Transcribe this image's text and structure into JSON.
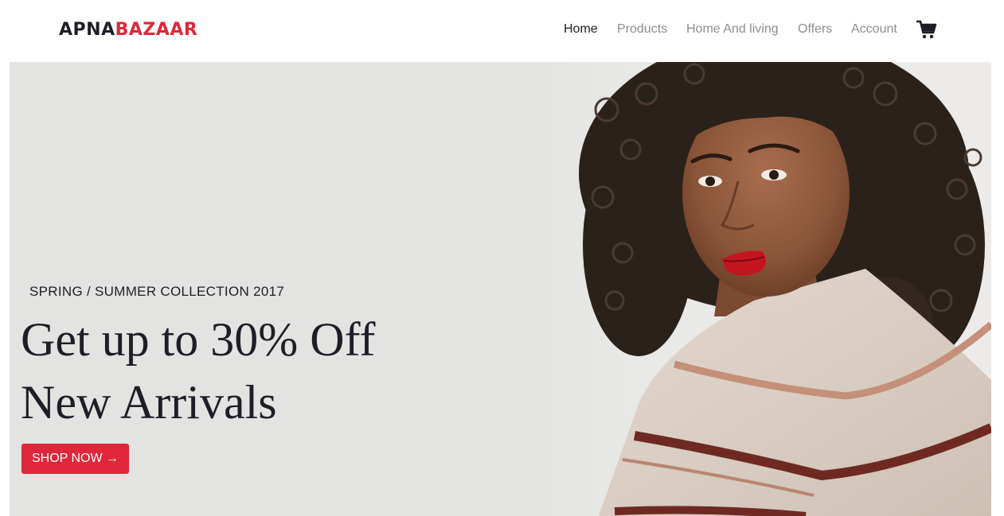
{
  "brand": {
    "part1": "APNA",
    "part2": "BAZAAR",
    "accent_color": "#e0263a",
    "dark_color": "#1e1e27"
  },
  "nav": {
    "items": [
      {
        "label": "Home",
        "active": true
      },
      {
        "label": "Products",
        "active": false
      },
      {
        "label": "Home And living",
        "active": false
      },
      {
        "label": "Offers",
        "active": false
      },
      {
        "label": "Account",
        "active": false
      }
    ],
    "cart_icon": "shopping-cart-icon"
  },
  "hero": {
    "subtitle": "SPRING / SUMMER COLLECTION 2017",
    "headline_line1": "Get up to 30% Off",
    "headline_line2": "New Arrivals",
    "button_label": "SHOP NOW →",
    "image": "model-in-striped-sweater"
  }
}
